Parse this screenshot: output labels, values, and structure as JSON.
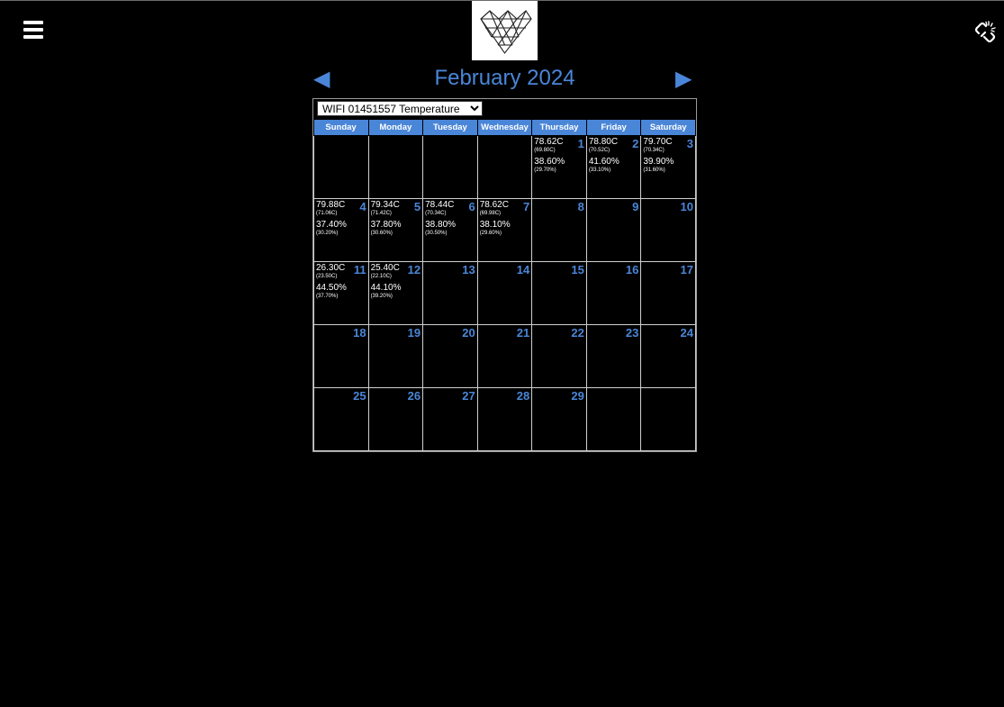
{
  "header": {
    "month_title": "February 2024",
    "prev_arrow": "◀",
    "next_arrow": "▶"
  },
  "sensor_select": {
    "selected": "WIFI 01451557 Temperature",
    "options": [
      "WIFI 01451557 Temperature"
    ]
  },
  "weekdays": [
    "Sunday",
    "Monday",
    "Tuesday",
    "Wednesday",
    "Thursday",
    "Friday",
    "Saturday"
  ],
  "days": [
    {
      "day": "1",
      "temp": "78.62C",
      "temp_sub": "(69.80C)",
      "hum": "38.60%",
      "hum_sub": "(29.70%)"
    },
    {
      "day": "2",
      "temp": "78.80C",
      "temp_sub": "(70.52C)",
      "hum": "41.60%",
      "hum_sub": "(33.10%)"
    },
    {
      "day": "3",
      "temp": "79.70C",
      "temp_sub": "(70.34C)",
      "hum": "39.90%",
      "hum_sub": "(31.60%)"
    },
    {
      "day": "4",
      "temp": "79.88C",
      "temp_sub": "(71.06C)",
      "hum": "37.40%",
      "hum_sub": "(30.20%)"
    },
    {
      "day": "5",
      "temp": "79.34C",
      "temp_sub": "(71.42C)",
      "hum": "37.80%",
      "hum_sub": "(30.60%)"
    },
    {
      "day": "6",
      "temp": "78.44C",
      "temp_sub": "(70.34C)",
      "hum": "38.80%",
      "hum_sub": "(30.50%)"
    },
    {
      "day": "7",
      "temp": "78.62C",
      "temp_sub": "(69.98C)",
      "hum": "38.10%",
      "hum_sub": "(29.60%)"
    },
    {
      "day": "8"
    },
    {
      "day": "9"
    },
    {
      "day": "10"
    },
    {
      "day": "11",
      "temp": "26.30C",
      "temp_sub": "(23.50C)",
      "hum": "44.50%",
      "hum_sub": "(37.70%)"
    },
    {
      "day": "12",
      "temp": "25.40C",
      "temp_sub": "(22.10C)",
      "hum": "44.10%",
      "hum_sub": "(39.20%)"
    },
    {
      "day": "13"
    },
    {
      "day": "14"
    },
    {
      "day": "15"
    },
    {
      "day": "16"
    },
    {
      "day": "17"
    },
    {
      "day": "18"
    },
    {
      "day": "19"
    },
    {
      "day": "20"
    },
    {
      "day": "21"
    },
    {
      "day": "22"
    },
    {
      "day": "23"
    },
    {
      "day": "24"
    },
    {
      "day": "25"
    },
    {
      "day": "26"
    },
    {
      "day": "27"
    },
    {
      "day": "28"
    },
    {
      "day": "29"
    }
  ],
  "colors": {
    "accent": "#4a86d8",
    "background": "#000000"
  },
  "icons": {
    "menu": "hamburger-menu-icon",
    "logo": "diamond-logo",
    "connection": "broken-link-icon"
  }
}
